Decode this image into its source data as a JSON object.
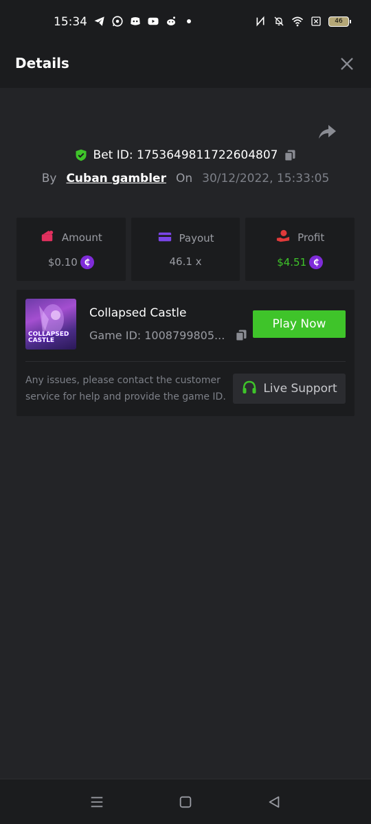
{
  "status_bar": {
    "time": "15:34",
    "battery": "46",
    "left_icons": [
      "telegram-icon",
      "whatsapp-icon",
      "discord-icon",
      "youtube-icon",
      "reddit-icon",
      "dot-icon"
    ],
    "right_icons": [
      "nfc-icon",
      "bell-off-icon",
      "wifi-icon",
      "sim-off-icon"
    ]
  },
  "header": {
    "title": "Details"
  },
  "bet": {
    "id_label": "Bet ID: 1753649811722604807",
    "by_label": "By",
    "username": "Cuban gambler",
    "on_label": "On",
    "datetime": "30/12/2022, 15:33:05"
  },
  "stats": {
    "amount_label": "Amount",
    "amount_value": "$0.10",
    "payout_label": "Payout",
    "payout_value": "46.1 x",
    "profit_label": "Profit",
    "profit_value": "$4.51"
  },
  "game": {
    "thumb_text": "COLLAPSED CASTLE",
    "title": "Collapsed Castle",
    "id_label": "Game ID: 1008799805...",
    "play_label": "Play Now",
    "support_text": "Any issues, please contact the customer service for help and provide the game ID.",
    "support_label": "Live Support"
  },
  "colors": {
    "background": "#232427",
    "panel": "#1b1c1e",
    "green": "#3fc42a",
    "coin": "#7f2cd9",
    "amount_icon": "#e0305e",
    "payout_icon": "#7b45e8",
    "profit_icon": "#e03a3a"
  }
}
